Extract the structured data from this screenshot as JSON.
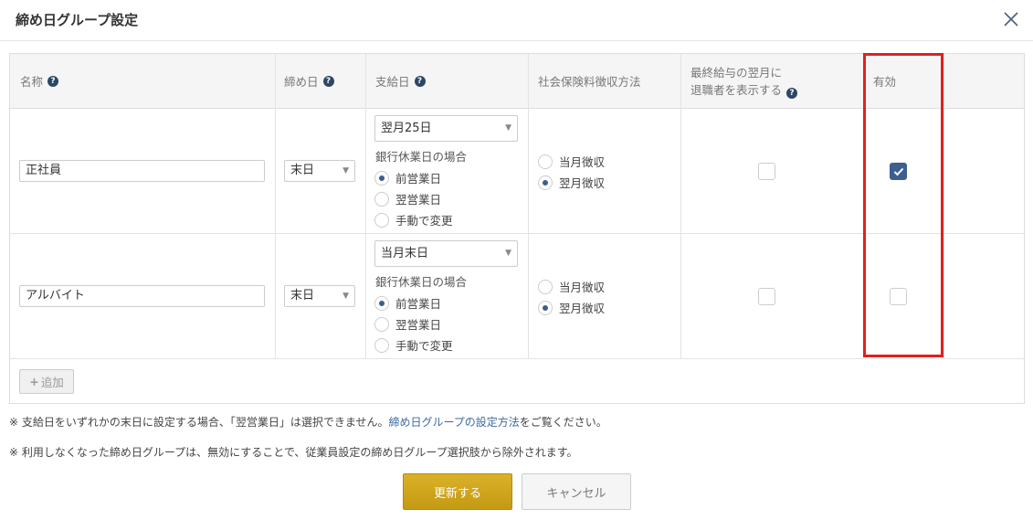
{
  "dialog": {
    "title": "締め日グループ設定",
    "close_icon": "close-icon"
  },
  "table": {
    "headers": {
      "name": "名称",
      "closing_day": "締め日",
      "pay_day": "支給日",
      "social_insurance": "社会保険料徴収方法",
      "show_retired_line1": "最終給与の翌月に",
      "show_retired_line2": "退職者を表示する",
      "active": "有効",
      "help_glyph": "?"
    },
    "rows": [
      {
        "name": "正社員",
        "closing_day": "末日",
        "pay_day": "翌月25日",
        "holiday_label": "銀行休業日の場合",
        "holiday_options": [
          "前営業日",
          "翌営業日",
          "手動で変更"
        ],
        "holiday_selected": "前営業日",
        "insurance_options": [
          "当月徴収",
          "翌月徴収"
        ],
        "insurance_selected": "翌月徴収",
        "show_retired": false,
        "active": true
      },
      {
        "name": "アルバイト",
        "closing_day": "末日",
        "pay_day": "当月末日",
        "holiday_label": "銀行休業日の場合",
        "holiday_options": [
          "前営業日",
          "翌営業日",
          "手動で変更"
        ],
        "holiday_selected": "前営業日",
        "insurance_options": [
          "当月徴収",
          "翌月徴収"
        ],
        "insurance_selected": "翌月徴収",
        "show_retired": false,
        "active": false
      }
    ],
    "add_button": "追加"
  },
  "notes": {
    "note1_prefix": "※ 支給日をいずれかの末日に設定する場合、「翌営業日」は選択できません。",
    "note1_link": "締め日グループの設定方法",
    "note1_suffix": "をご覧ください。",
    "note2": "※ 利用しなくなった締め日グループは、無効にすることで、従業員設定の締め日グループ選択肢から除外されます。"
  },
  "buttons": {
    "submit": "更新する",
    "cancel": "キャンセル"
  },
  "colors": {
    "primary": "#c9a017",
    "highlight": "#e02020",
    "checkbox_on": "#3d5f8f",
    "link": "#3b6aa0"
  }
}
